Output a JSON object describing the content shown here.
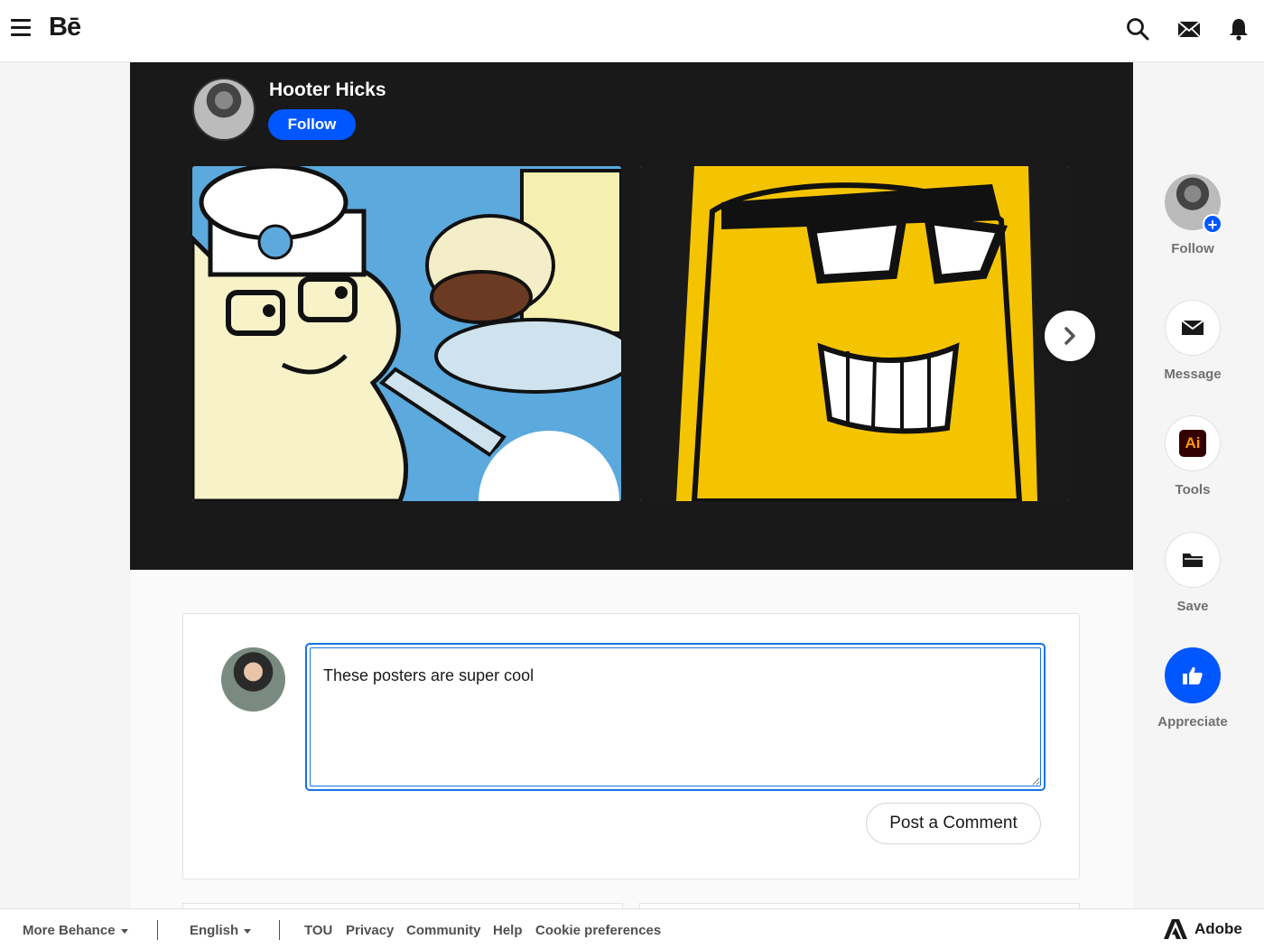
{
  "app": {
    "logo_text": "Bē"
  },
  "topnav": {
    "icons": [
      "menu-icon",
      "search-icon",
      "mail-icon",
      "bell-icon"
    ]
  },
  "project": {
    "owner_name": "Hooter Hicks",
    "follow_label": "Follow",
    "artworks": [
      "artwork-chef-burger",
      "artwork-sunglasses-face"
    ],
    "colors": {
      "hero_bg": "#191919",
      "accent": "#0057ff"
    }
  },
  "comment": {
    "text": "These posters are super cool",
    "post_label": "Post a Comment"
  },
  "rail": {
    "follow_label": "Follow",
    "message_label": "Message",
    "tools_label": "Tools",
    "tools_badge": "Ai",
    "save_label": "Save",
    "appreciate_label": "Appreciate"
  },
  "footer": {
    "more_behance": "More Behance",
    "language": "English",
    "links": [
      "TOU",
      "Privacy",
      "Community",
      "Help",
      "Cookie preferences"
    ],
    "adobe_label": "Adobe"
  }
}
